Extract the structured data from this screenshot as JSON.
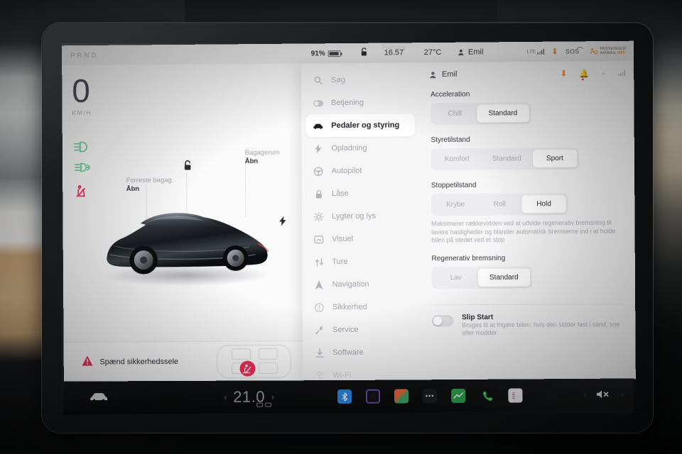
{
  "statusbar": {
    "prnd": "PRND",
    "battery_percent": "91%",
    "lock_icon": "unlock-icon",
    "time": "16.57",
    "ghost_text": "Fuglsang",
    "temperature": "27°C",
    "user": "Emil",
    "network": "LTE",
    "download_icon": "download-icon",
    "sos": "SOS",
    "airbag_line1": "PASSENGER",
    "airbag_line2": "AIRBAG",
    "airbag_state": "OFF"
  },
  "drive": {
    "speed": "0",
    "speed_unit": "KM/H",
    "telltales": [
      {
        "name": "low-beam-icon",
        "color": "#58c98a"
      },
      {
        "name": "fog-light-icon",
        "color": "#58c98a"
      },
      {
        "name": "seatbelt-warning-icon",
        "color": "#f0315c"
      }
    ],
    "front_trunk_label": "Forreste bagag.",
    "front_trunk_action": "Åbn",
    "trunk_label": "Bagagerum",
    "trunk_action": "Åbn",
    "page_dots": 3,
    "page_active": 0,
    "warning": "Spænd sikkerhedssele"
  },
  "settings": {
    "search_placeholder": "Søg",
    "menu": [
      {
        "label": "Betjening",
        "icon": "toggle-icon",
        "active": false
      },
      {
        "label": "Pedaler og styring",
        "icon": "car-icon",
        "active": true
      },
      {
        "label": "Opladning",
        "icon": "bolt-icon",
        "active": false
      },
      {
        "label": "Autopilot",
        "icon": "steering-wheel-icon",
        "active": false
      },
      {
        "label": "Låse",
        "icon": "lock-icon",
        "active": false
      },
      {
        "label": "Lygter og lys",
        "icon": "light-icon",
        "active": false
      },
      {
        "label": "Visuel",
        "icon": "display-icon",
        "active": false
      },
      {
        "label": "Ture",
        "icon": "trips-icon",
        "active": false
      },
      {
        "label": "Navigation",
        "icon": "navigation-arrow-icon",
        "active": false
      },
      {
        "label": "Sikkerhed",
        "icon": "safety-icon",
        "active": false
      },
      {
        "label": "Service",
        "icon": "wrench-icon",
        "active": false
      },
      {
        "label": "Software",
        "icon": "download-icon",
        "active": false
      },
      {
        "label": "Wi-Fi",
        "icon": "wifi-icon",
        "active": false
      }
    ],
    "header_user": "Emil",
    "groups": [
      {
        "title": "Acceleration",
        "options": [
          "Chill",
          "Standard"
        ],
        "selected": 1
      },
      {
        "title": "Styretilstand",
        "options": [
          "Komfort",
          "Standard",
          "Sport"
        ],
        "selected": 2
      },
      {
        "title": "Stoppetilstand",
        "options": [
          "Krybe",
          "Roll",
          "Hold"
        ],
        "selected": 2,
        "description": "Maksimerer rækkevidden ved at udvide regenerativ bremsning til lavere hastigheder og blander automatisk bremserne ind i at holde bilen på stedet ved et stop"
      },
      {
        "title": "Regenerativ bremsning",
        "options": [
          "Lav",
          "Standard"
        ],
        "selected": 1
      }
    ],
    "toggle": {
      "title": "Slip Start",
      "description": "Bruges til at frigøre bilen, hvis den sidder fast i sand, sne eller mudder.",
      "state": "off"
    }
  },
  "taskbar": {
    "temperature": "21.0",
    "chevron_left": "‹",
    "chevron_right": "›",
    "apps": [
      {
        "name": "bluetooth-app-icon",
        "glyph": "✦"
      },
      {
        "name": "media-app-icon",
        "glyph": ""
      },
      {
        "name": "apps-icon",
        "glyph": ""
      },
      {
        "name": "more-dots-icon",
        "glyph": "•••"
      },
      {
        "name": "chart-app-icon",
        "glyph": ""
      },
      {
        "name": "phone-app-icon",
        "glyph": "✆"
      },
      {
        "name": "radio-app-icon",
        "glyph": ""
      }
    ],
    "mute_icon": "mute-icon"
  },
  "colors": {
    "accent_orange": "#e8963c",
    "warning_red": "#f0315c",
    "telltale_green": "#58c98a",
    "panel_bg": "#f6f6f7"
  }
}
